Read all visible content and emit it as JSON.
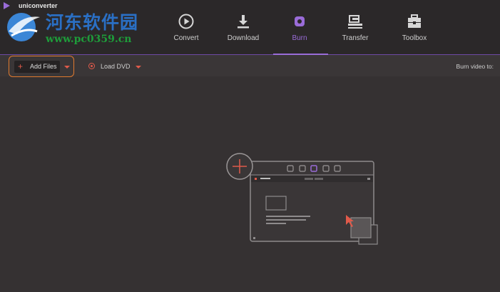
{
  "app": {
    "name": "uniconverter"
  },
  "watermark": {
    "site_name": "河东软件园",
    "url": "www.pc0359.cn"
  },
  "nav": {
    "items": [
      {
        "id": "convert",
        "label": "Convert",
        "icon": "convert-play-icon"
      },
      {
        "id": "download",
        "label": "Download",
        "icon": "download-icon"
      },
      {
        "id": "burn",
        "label": "Burn",
        "icon": "burn-disc-icon",
        "active": true
      },
      {
        "id": "transfer",
        "label": "Transfer",
        "icon": "transfer-icon"
      },
      {
        "id": "toolbox",
        "label": "Toolbox",
        "icon": "toolbox-icon"
      }
    ]
  },
  "toolbar": {
    "add_files_label": "Add Files",
    "load_dvd_label": "Load DVD",
    "burn_video_to_label": "Burn video to:"
  },
  "colors": {
    "accent_purple": "#9a6cd8",
    "accent_red": "#e05a4a",
    "highlight_orange": "#e07a2e",
    "background": "#353132"
  }
}
